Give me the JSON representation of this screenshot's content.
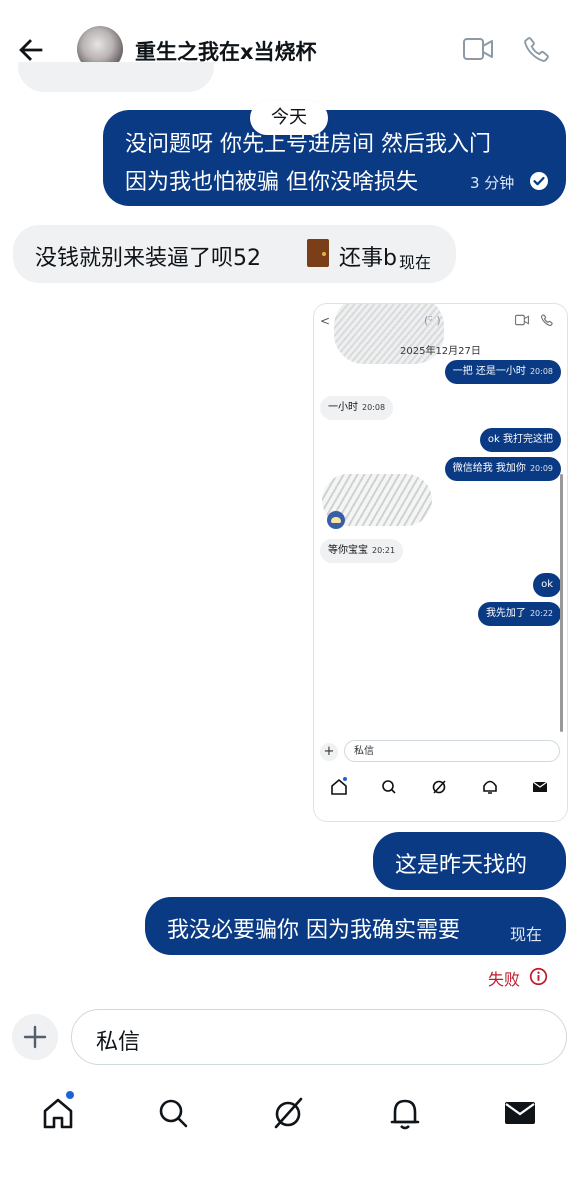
{
  "header": {
    "title": "重生之我在x当烧杯"
  },
  "icons": {
    "back": "back-arrow-icon",
    "video": "video-call-icon",
    "phone": "phone-call-icon",
    "check": "check-circle-icon",
    "failed": "info-icon"
  },
  "colors": {
    "outgoing_bubble": "#0b3a84",
    "incoming_bubble": "#eff1f2",
    "failed_text": "#c01b2f",
    "nav_dot": "#1d63d6"
  },
  "messages": {
    "date_divider": "今天",
    "m1": {
      "line1": "没问题呀 你先上号进房间 然后我入门",
      "line2": "因为我也怕被骗 但你没啥损失",
      "time": "3 分钟"
    },
    "m2": {
      "text": "没钱就别来装逼了呗52",
      "text2": "还事b",
      "time": "现在"
    },
    "m3": {
      "text": "这是昨天找的"
    },
    "m4": {
      "text": "我没必要骗你 因为我确实需要",
      "time": "现在",
      "status": "失败"
    }
  },
  "embedded_screenshot": {
    "title": "(ᵕ̈ )",
    "date": "2025年12月27日",
    "messages": [
      {
        "dir": "out",
        "text": "一把 还是一小时",
        "time": "20:08"
      },
      {
        "dir": "in",
        "text": "一小时",
        "time": "20:08"
      },
      {
        "dir": "out",
        "text": "ok 我打完这把",
        "time": ""
      },
      {
        "dir": "out",
        "text": "微信给我 我加你",
        "time": "20:09"
      },
      {
        "dir": "in",
        "text": "等你宝宝",
        "time": "20:21"
      },
      {
        "dir": "out",
        "text": "ok",
        "time": ""
      },
      {
        "dir": "out",
        "text": "我先加了",
        "time": "20:22"
      }
    ],
    "composer_placeholder": "私信"
  },
  "composer": {
    "placeholder": "私信"
  },
  "bottom_nav": [
    "home-icon",
    "search-icon",
    "grok-icon",
    "notifications-icon",
    "messages-icon"
  ]
}
